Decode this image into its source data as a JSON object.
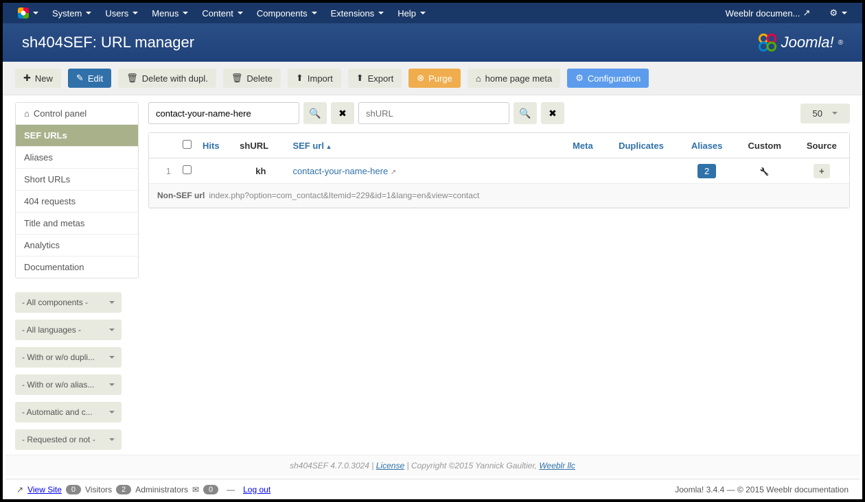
{
  "topnav": {
    "left": [
      {
        "label": "System"
      },
      {
        "label": "Users"
      },
      {
        "label": "Menus"
      },
      {
        "label": "Content"
      },
      {
        "label": "Components"
      },
      {
        "label": "Extensions"
      },
      {
        "label": "Help"
      }
    ],
    "right_label": "Weeblr documen..."
  },
  "header": {
    "title": "sh404SEF: URL manager",
    "brand": "Joomla!"
  },
  "toolbar": {
    "new": "New",
    "edit": "Edit",
    "delete_dupl": "Delete with dupl.",
    "delete": "Delete",
    "import": "Import",
    "export": "Export",
    "purge": "Purge",
    "homepage_meta": "home page meta",
    "config": "Configuration"
  },
  "sidebar": {
    "items": [
      {
        "label": "Control panel",
        "cp": true
      },
      {
        "label": "SEF URLs",
        "active": true
      },
      {
        "label": "Aliases"
      },
      {
        "label": "Short URLs"
      },
      {
        "label": "404 requests"
      },
      {
        "label": "Title and metas"
      },
      {
        "label": "Analytics"
      },
      {
        "label": "Documentation"
      }
    ],
    "filters": [
      "- All components -",
      "- All languages -",
      "- With or w/o dupli...",
      "- With or w/o alias...",
      "- Automatic and c...",
      "- Requested or not -"
    ]
  },
  "search": {
    "value": "contact-your-name-here",
    "placeholder2": "shURL",
    "limit": "50"
  },
  "table": {
    "headers": {
      "hits": "Hits",
      "shurl": "shURL",
      "sefurl": "SEF url",
      "meta": "Meta",
      "dup": "Duplicates",
      "aliases": "Aliases",
      "custom": "Custom",
      "source": "Source"
    },
    "row": {
      "num": "1",
      "shurl": "kh",
      "sefurl": "contact-your-name-here",
      "aliases": "2",
      "source": "+"
    },
    "nonsef_label": "Non-SEF url",
    "nonsef_value": "index.php?option=com_contact&Itemid=229&id=1&lang=en&view=contact"
  },
  "footer": {
    "version_prefix": "sh404SEF 4.7.0.3024 | ",
    "license": "License",
    "copyright": " | Copyright ©2015 Yannick Gaultier, ",
    "weeblr": "Weeblr llc"
  },
  "statusbar": {
    "viewsite": "View Site",
    "visitors_n": "0",
    "visitors": "Visitors",
    "admins_n": "2",
    "admins": "Administrators",
    "msgs_n": "0",
    "logout": "Log out",
    "right": "Joomla! 3.4.4 — © 2015 Weeblr documentation"
  }
}
